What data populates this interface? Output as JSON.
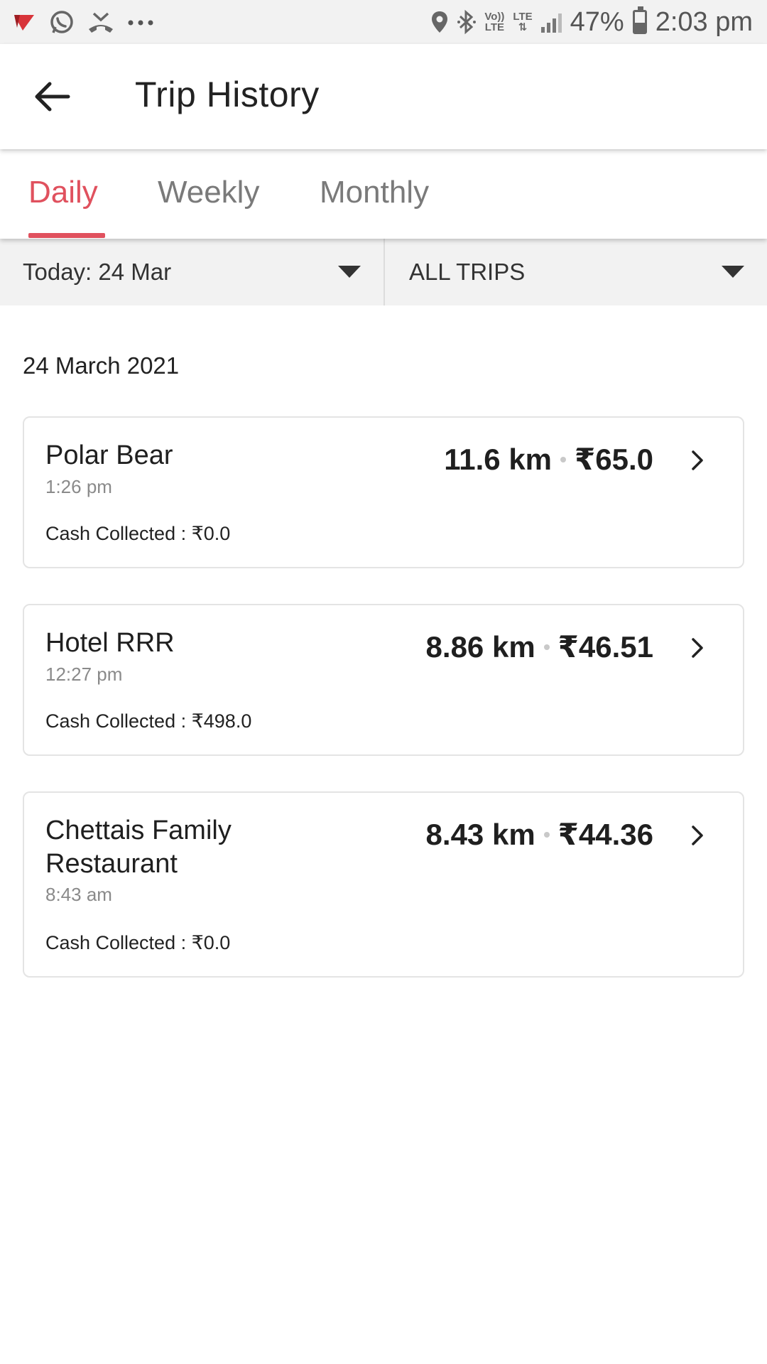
{
  "status_bar": {
    "battery": "47%",
    "battery_level": 0.47,
    "time": "2:03 pm",
    "volte_line1": "Vo))",
    "volte_line2": "LTE",
    "lte": "LTE",
    "icons_left": [
      "airtel-flag-icon",
      "whatsapp-icon",
      "missed-call-icon",
      "more-dots-icon"
    ],
    "icons_right": [
      "location-icon",
      "bluetooth-icon",
      "volte-icon",
      "lte-icon",
      "signal-icon",
      "battery-icon"
    ]
  },
  "app_bar": {
    "title": "Trip History",
    "back_icon": "arrow-left-icon"
  },
  "tabs": [
    {
      "label": "Daily",
      "active": true
    },
    {
      "label": "Weekly",
      "active": false
    },
    {
      "label": "Monthly",
      "active": false
    }
  ],
  "filters": {
    "date": "Today: 24 Mar",
    "trip_type": "ALL TRIPS"
  },
  "date_heading": "24 March 2021",
  "trips": [
    {
      "name_line1": "Polar Bear",
      "name_line2": "",
      "time": "1:26 pm",
      "distance": "11.6 km",
      "fare": "₹65.0",
      "cash": "Cash Collected : ₹0.0"
    },
    {
      "name_line1": "Hotel RRR",
      "name_line2": "",
      "time": "12:27 pm",
      "distance": "8.86 km",
      "fare": "₹46.51",
      "cash": "Cash Collected : ₹498.0"
    },
    {
      "name_line1": "Chettais Family",
      "name_line2": "Restaurant",
      "time": "8:43 am",
      "distance": "8.43 km",
      "fare": "₹44.36",
      "cash": "Cash Collected : ₹0.0"
    }
  ],
  "colors": {
    "accent": "#e0515e",
    "status_bar_bg": "#f2f2f2",
    "filter_bg": "#f2f2f2",
    "card_border": "#e4e4e4"
  }
}
